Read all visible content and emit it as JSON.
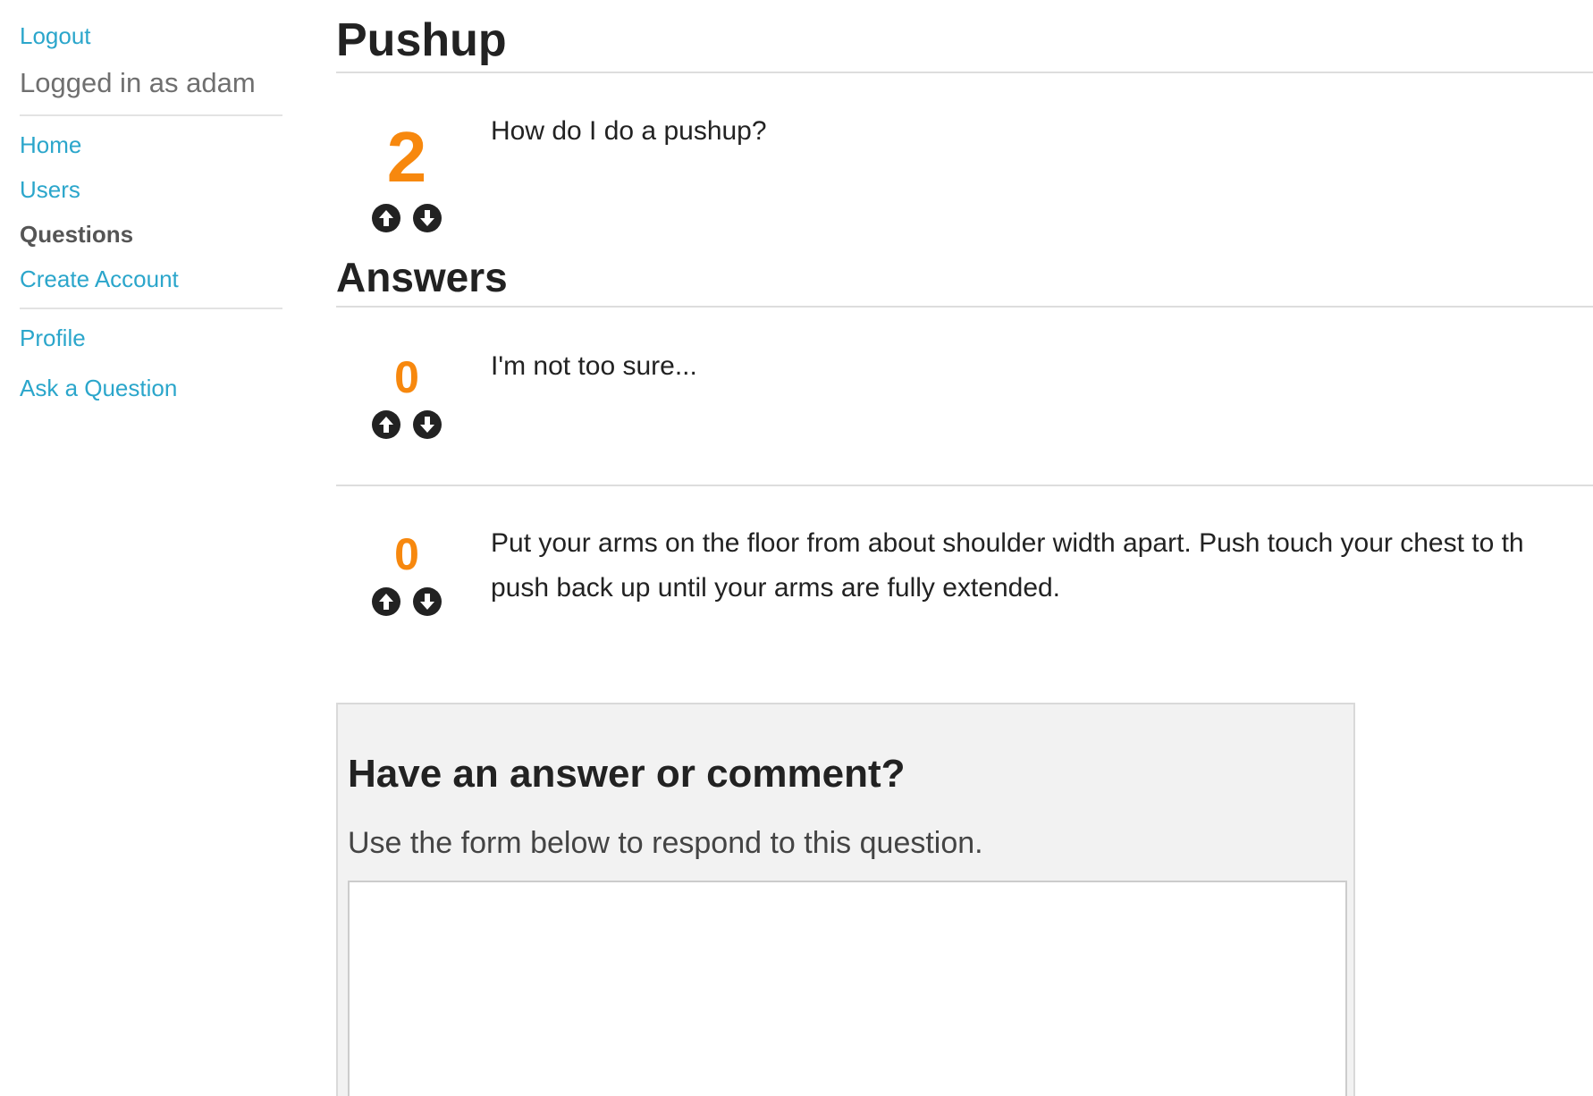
{
  "sidebar": {
    "logout_label": "Logout",
    "logged_in_text": "Logged in as adam",
    "nav": {
      "home": "Home",
      "users": "Users",
      "questions": "Questions",
      "create_account": "Create Account"
    },
    "user_nav": {
      "profile": "Profile",
      "ask_question": "Ask a Question"
    }
  },
  "question": {
    "title": "Pushup",
    "score": "2",
    "body": "How do I do a pushup?"
  },
  "answers_heading": "Answers",
  "answers": [
    {
      "score": "0",
      "body_lines": [
        "I'm not too sure..."
      ]
    },
    {
      "score": "0",
      "body_lines": [
        "Put your arms on the floor from about shoulder width apart. Push touch your chest to th",
        "push back up until your arms are fully extended."
      ]
    }
  ],
  "form": {
    "title": "Have an answer or comment?",
    "subtitle": "Use the form below to respond to this question.",
    "textarea_value": ""
  },
  "icons": {
    "upvote": "arrow-up-circle-icon",
    "downvote": "arrow-down-circle-icon"
  },
  "colors": {
    "link": "#2ba6cb",
    "score": "#f7880e",
    "panel_bg": "#f2f2f2"
  }
}
